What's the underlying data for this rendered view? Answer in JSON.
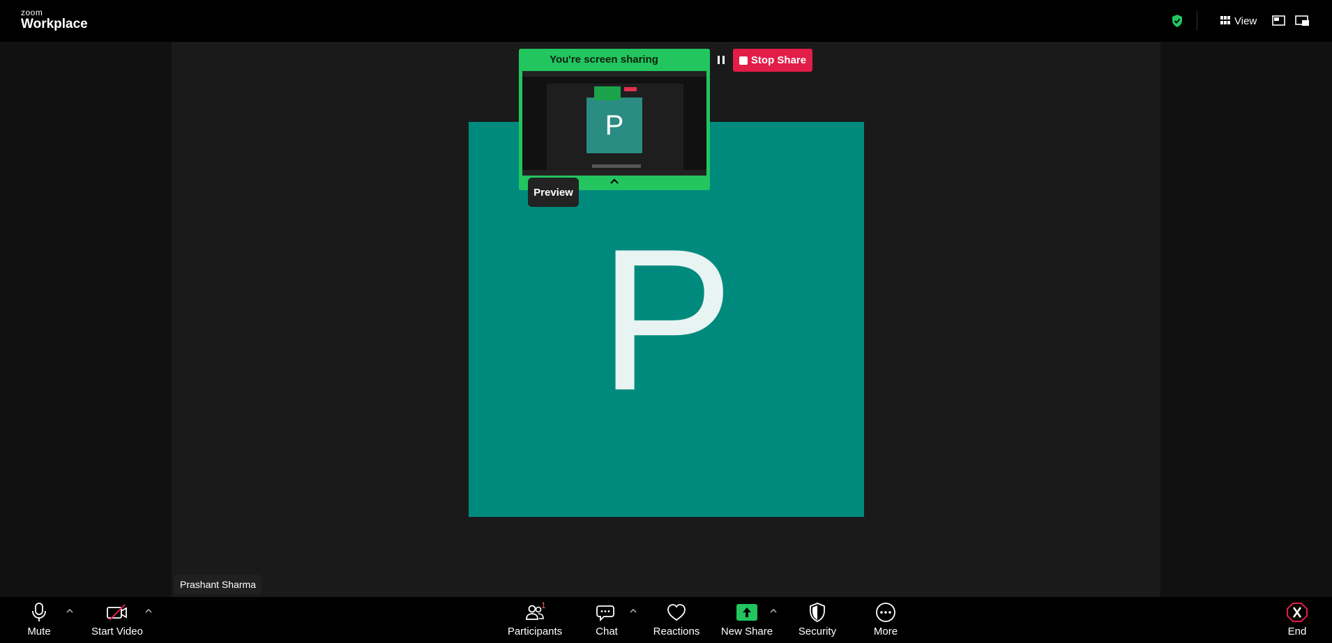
{
  "app": {
    "logo_line1": "zoom",
    "logo_line2": "Workplace"
  },
  "header": {
    "view_label": "View",
    "shield_color": "#22c55e"
  },
  "share": {
    "status_text": "You're screen sharing",
    "stop_label": "Stop Share",
    "preview_label": "Preview",
    "thumb_letter": "P",
    "panel_color": "#22c55e",
    "stop_color": "#e11d48"
  },
  "main": {
    "avatar_letter": "P",
    "avatar_color": "#008a7e",
    "participant_name": "Prashant Sharma"
  },
  "toolbar": {
    "mute": "Mute",
    "start_video": "Start Video",
    "participants": "Participants",
    "participants_count": "1",
    "chat": "Chat",
    "reactions": "Reactions",
    "new_share": "New Share",
    "security": "Security",
    "more": "More",
    "end": "End",
    "new_share_color": "#22c55e",
    "end_color": "#e11d48"
  }
}
